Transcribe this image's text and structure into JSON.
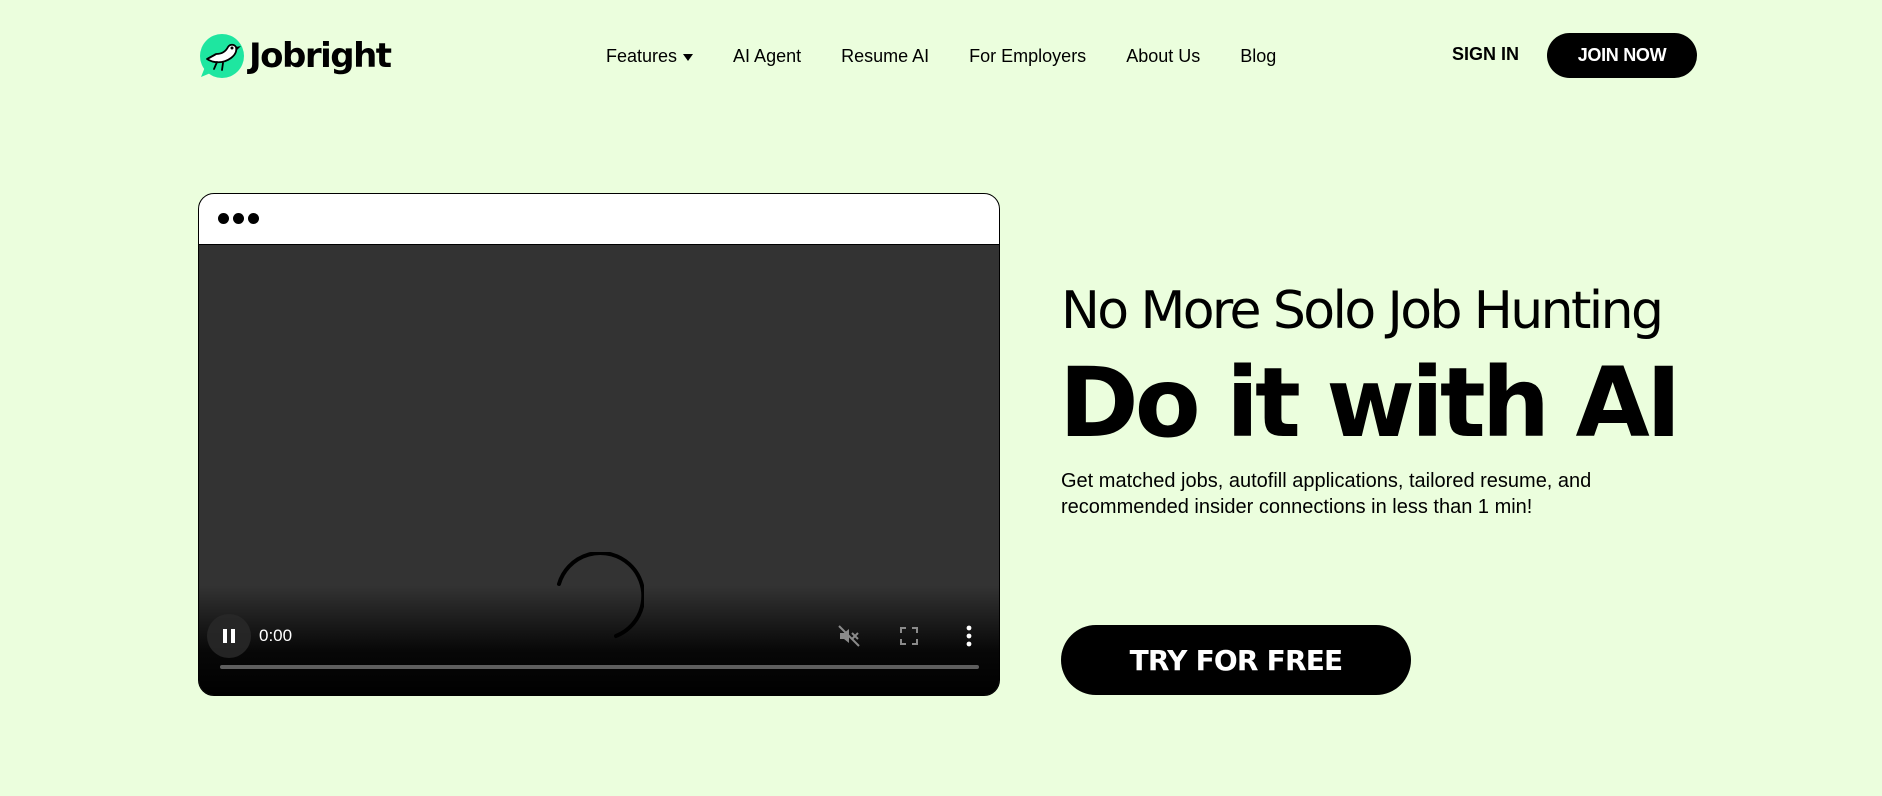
{
  "brand": {
    "name": "Jobright",
    "accent_color": "#1ee6a0",
    "background_color": "#ebfedd"
  },
  "nav": {
    "items": [
      {
        "label": "Features",
        "has_dropdown": true
      },
      {
        "label": "AI Agent"
      },
      {
        "label": "Resume AI"
      },
      {
        "label": "For Employers"
      },
      {
        "label": "About Us"
      },
      {
        "label": "Blog"
      }
    ],
    "sign_in": "SIGN IN",
    "join_now": "JOIN NOW"
  },
  "video": {
    "time": "0:00",
    "state": "loading",
    "muted": true,
    "progress": 0
  },
  "hero": {
    "headline": "No More Solo Job Hunting",
    "title": "Do it with AI",
    "description": "Get matched jobs, autofill applications, tailored resume, and recommended insider connections in less than 1 min!",
    "cta": "TRY FOR FREE"
  }
}
